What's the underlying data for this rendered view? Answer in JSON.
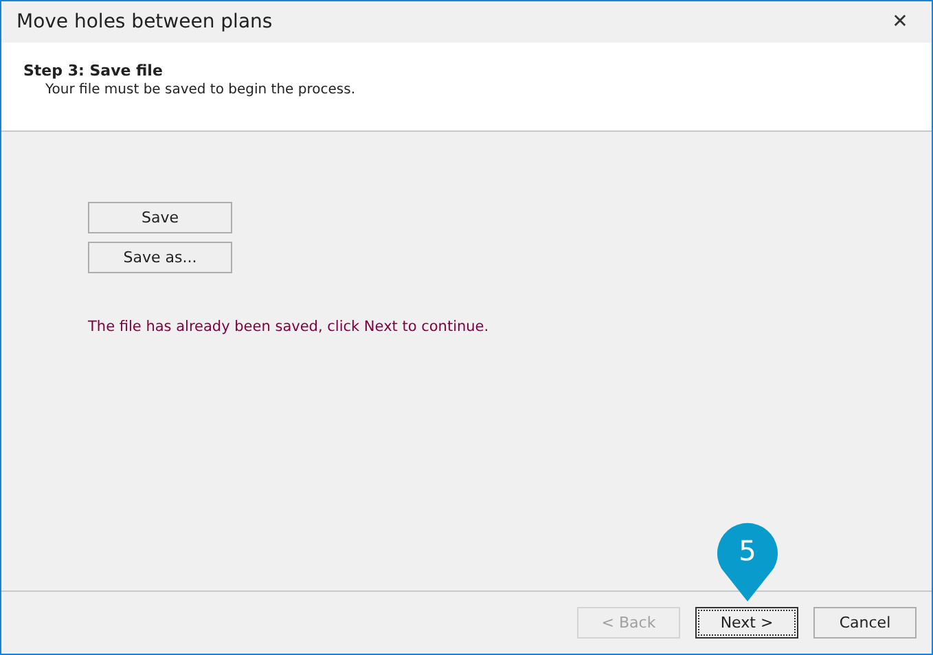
{
  "window": {
    "title": "Move holes between plans",
    "close_glyph": "✕"
  },
  "header": {
    "title": "Step 3: Save file",
    "subtitle": "Your file must be saved to begin the process."
  },
  "actions": [
    {
      "label": "Save"
    },
    {
      "label": "Save as..."
    }
  ],
  "status_message": "The file has already been saved, click Next to continue.",
  "footer_buttons": [
    {
      "label": "< Back",
      "disabled": true,
      "focused": false
    },
    {
      "label": "Next >",
      "disabled": false,
      "focused": true,
      "callout": "5"
    },
    {
      "label": "Cancel",
      "disabled": false,
      "focused": false
    }
  ]
}
